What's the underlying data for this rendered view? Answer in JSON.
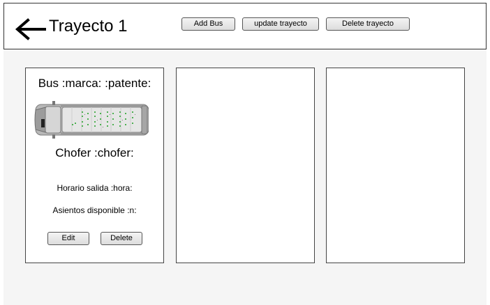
{
  "header": {
    "title": "Trayecto 1",
    "back_icon": "arrow-left-icon",
    "buttons": {
      "add_bus": "Add Bus",
      "update_trayecto": "update trayecto",
      "delete_trayecto": "Delete trayecto"
    }
  },
  "cards": [
    {
      "bus_title": "Bus :marca: :patente:",
      "image_icon": "van-icon",
      "chofer": "Chofer :chofer:",
      "horario": "Horario salida :hora:",
      "asientos": "Asientos disponible :n:",
      "edit_label": "Edit",
      "delete_label": "Delete"
    },
    {},
    {}
  ],
  "colors": {
    "border": "#444444",
    "button_top": "#f4f4f4",
    "button_bottom": "#dcdcdc",
    "background": "#f5f5f5",
    "van_body": "#b8b8b8",
    "van_dark": "#8a8a8a",
    "seat_dots": "#4caf50"
  }
}
